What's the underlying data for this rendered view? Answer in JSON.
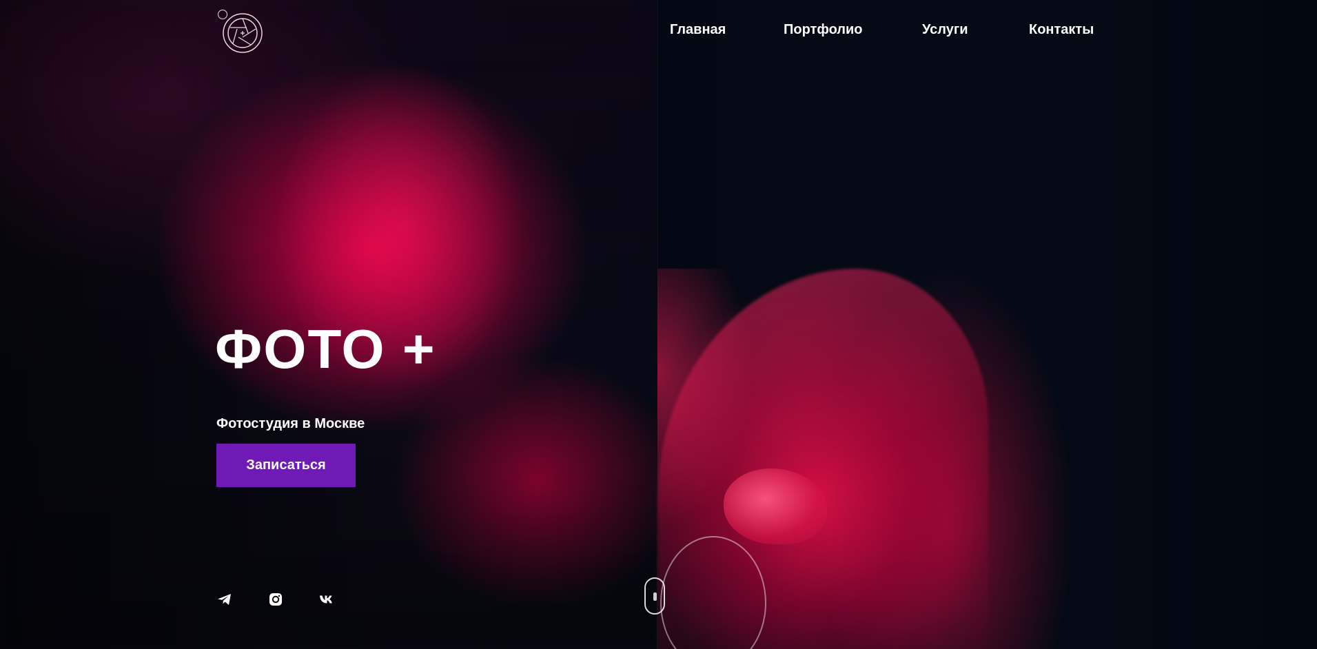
{
  "brand": {
    "logo_icon": "camera-aperture-icon"
  },
  "nav": {
    "items": [
      {
        "label": "Главная"
      },
      {
        "label": "Портфолио"
      },
      {
        "label": "Услуги"
      },
      {
        "label": "Контакты"
      }
    ]
  },
  "hero": {
    "title": "ФОТО +",
    "subtitle": "Фотостудия в Москве",
    "cta_label": "Записаться"
  },
  "socials": [
    {
      "icon": "telegram-icon"
    },
    {
      "icon": "instagram-icon"
    },
    {
      "icon": "vk-icon"
    }
  ],
  "scroll": {
    "icon": "mouse-scroll-icon"
  },
  "colors": {
    "accent": "#6f1ab6",
    "text": "#ffffff",
    "glow": "#ff0a5a"
  }
}
